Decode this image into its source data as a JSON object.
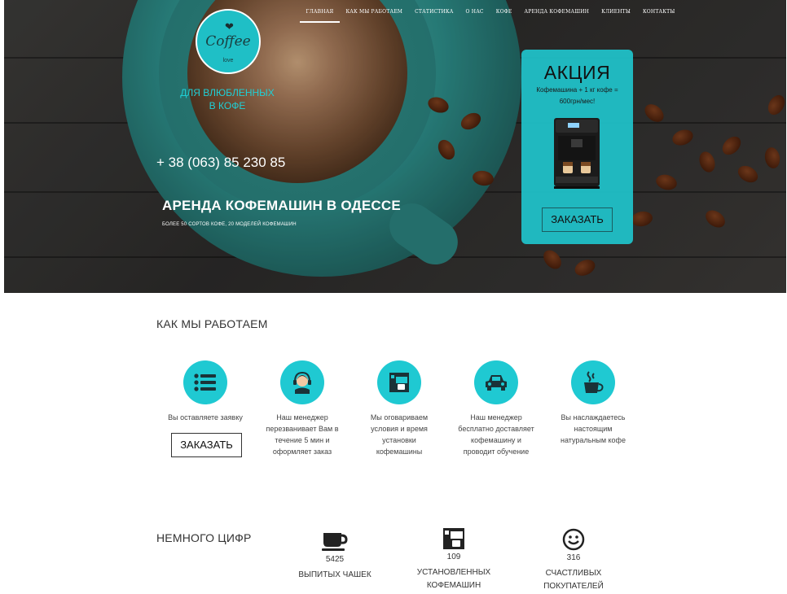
{
  "nav": {
    "items": [
      {
        "label": "ГЛАВНАЯ",
        "active": true
      },
      {
        "label": "КАК МЫ РАБОТАЕМ",
        "active": false
      },
      {
        "label": "СТАТИСТИКА",
        "active": false
      },
      {
        "label": "О НАС",
        "active": false
      },
      {
        "label": "КОФЕ",
        "active": false
      },
      {
        "label": "АРЕНДА КОФЕМАШИН",
        "active": false
      },
      {
        "label": "КЛИЕНТЫ",
        "active": false
      },
      {
        "label": "КОНТАКТЫ",
        "active": false
      }
    ]
  },
  "logo": {
    "word": "Coffee",
    "sub": "love"
  },
  "hero": {
    "tagline_line1": "ДЛЯ ВЛЮБЛЕННЫХ",
    "tagline_line2": "В КОФЕ",
    "phone": "+ 38 (063) 85 230 85",
    "title": "АРЕНДА КОФЕМАШИН В ОДЕССЕ",
    "subtitle": "БОЛЕЕ 50 СОРТОВ КОФЕ, 20 МОДЕЛЕЙ КОФЕМАШИН"
  },
  "promo": {
    "title": "АКЦИЯ",
    "text": "Кофемашина + 1 кг кофе = 600грн/мес!",
    "button": "ЗАКАЗАТЬ"
  },
  "how": {
    "title": "КАК МЫ РАБОТАЕМ",
    "order_button": "ЗАКАЗАТЬ",
    "steps": [
      {
        "icon": "list-icon",
        "text": "Вы оставляете заявку"
      },
      {
        "icon": "operator-headset-icon",
        "text": "Наш менеджер перезванивает Вам в течение 5 мин и оформляет заказ"
      },
      {
        "icon": "coffee-machine-icon",
        "text": "Мы оговариваем условия и время установки кофемашины"
      },
      {
        "icon": "car-icon",
        "text": "Наш менеджер бесплатно доставляет кофемашину и проводит обучение"
      },
      {
        "icon": "hot-cup-icon",
        "text": "Вы наслаждаетесь настоящим натуральным кофе"
      }
    ]
  },
  "stats": {
    "title": "НЕМНОГО ЦИФР",
    "items": [
      {
        "icon": "coffee-cup-icon",
        "value": "5425",
        "label": "ВЫПИТЫХ ЧАШЕК"
      },
      {
        "icon": "coffee-machine-icon",
        "value": "109",
        "label": "УСТАНОВЛЕННЫХ КОФЕМАШИН"
      },
      {
        "icon": "smiley-icon",
        "value": "316",
        "label": "СЧАСТЛИВЫХ ПОКУПАТЕЛЕЙ"
      }
    ]
  },
  "colors": {
    "accent": "#1fc9d2",
    "tagline": "#1fd0d6",
    "dark": "#333333"
  }
}
